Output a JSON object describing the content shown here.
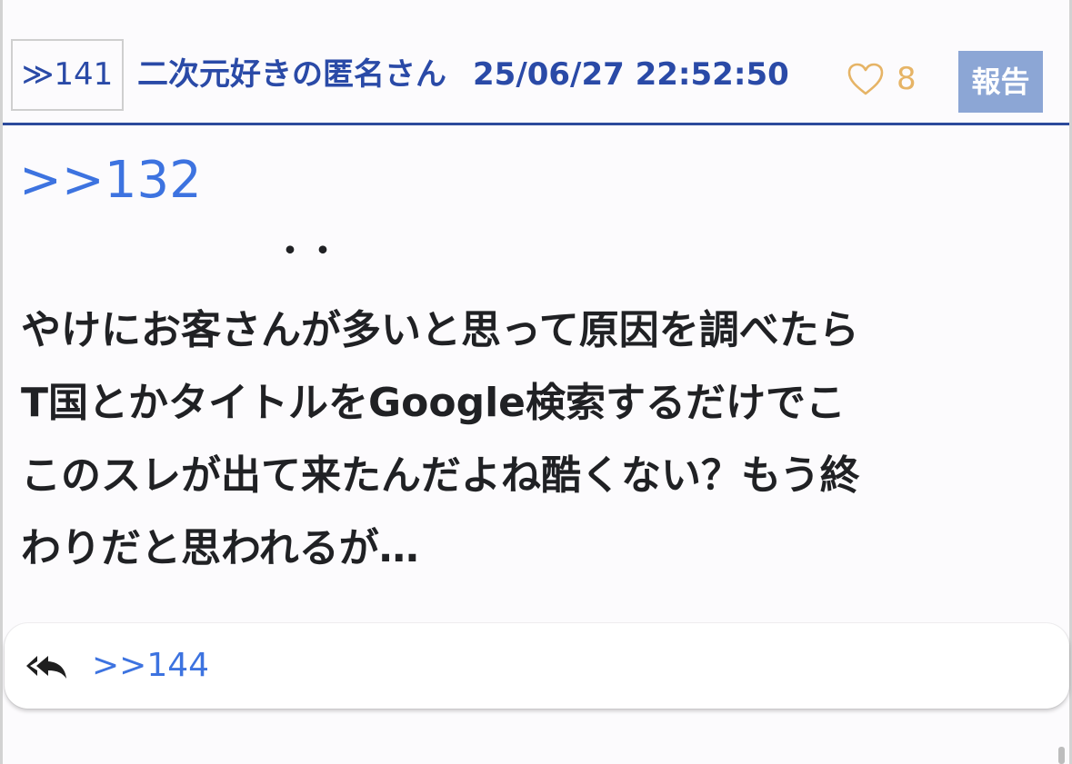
{
  "post": {
    "res_number": "≫141",
    "poster_name": "二次元好きの匿名さん",
    "date": "25/06/27 22:52:50",
    "like_count": "8",
    "report_label": "報告",
    "anchor": ">>132",
    "dots": "・・",
    "body_lines": [
      "やけにお客さんが多いと思って原因を調べたら",
      "T国とかタイトルをGoogle検索するだけでこ",
      "このスレが出て来たんだよね酷くない？もう終",
      "わりだと思われるが…"
    ]
  },
  "replies": {
    "links": [
      ">>144"
    ]
  },
  "icons": {
    "like": "heart-outline-icon",
    "reply": "reply-all-icon"
  },
  "colors": {
    "header_text": "#2a4aa7",
    "header_rule": "#2c4a9c",
    "link": "#3d73e0",
    "like": "#e6b466",
    "report_background": "#8ca6d5",
    "body_text": "#202124"
  }
}
